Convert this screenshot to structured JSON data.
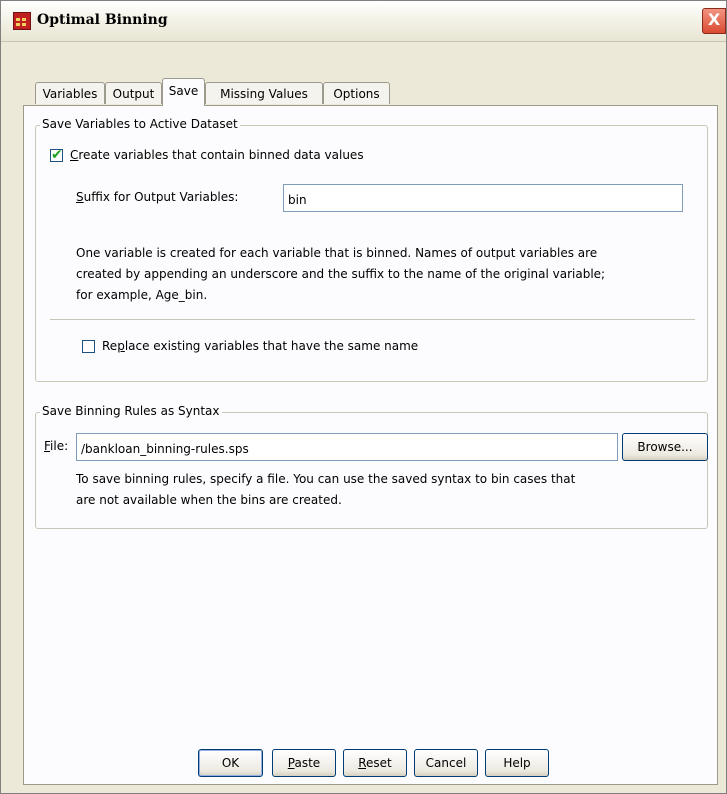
{
  "window": {
    "title": "Optimal Binning",
    "close_glyph": "X",
    "icon": "table-icon"
  },
  "tabs": [
    {
      "label": "Variables",
      "active": false
    },
    {
      "label": "Output",
      "active": false
    },
    {
      "label": "Save",
      "active": true
    },
    {
      "label": "Missing Values",
      "active": false
    },
    {
      "label": "Options",
      "active": false
    }
  ],
  "save_variables": {
    "group_title": "Save Variables to Active Dataset",
    "create_checkbox": {
      "mnemonic": "C",
      "label_rest": "reate variables that contain binned data values",
      "checked": true
    },
    "suffix_label_mnemonic": "S",
    "suffix_label_rest": "uffix for Output Variables:",
    "suffix_value": "bin",
    "description_lines": [
      "One variable is created for each variable that is binned. Names of output variables are",
      "created by appending an underscore and the suffix to the name of the original variable;",
      "for example, Age_bin."
    ],
    "replace_checkbox": {
      "label_pre": "Re",
      "mnemonic": "p",
      "label_rest": "lace existing variables that have the same name",
      "checked": false
    }
  },
  "save_rules": {
    "group_title": "Save Binning Rules as Syntax",
    "file_label_mnemonic": "F",
    "file_label_rest": "ile:",
    "file_value": "/bankloan_binning-rules.sps",
    "browse_label": "Browse...",
    "description_lines": [
      "To save binning rules, specify a file. You can use the saved syntax to bin cases that",
      "are not available when the bins are created."
    ]
  },
  "buttons": {
    "ok": "OK",
    "paste_mnemonic": "P",
    "paste_rest": "aste",
    "reset_mnemonic": "R",
    "reset_rest": "eset",
    "cancel": "Cancel",
    "help": "Help"
  },
  "colors": {
    "dialog_bg": "#ece9d8",
    "panel_bg": "#fcfcfe",
    "button_border": "#003c74",
    "checkmark": "#21a121",
    "close_button": "#d94a32"
  }
}
